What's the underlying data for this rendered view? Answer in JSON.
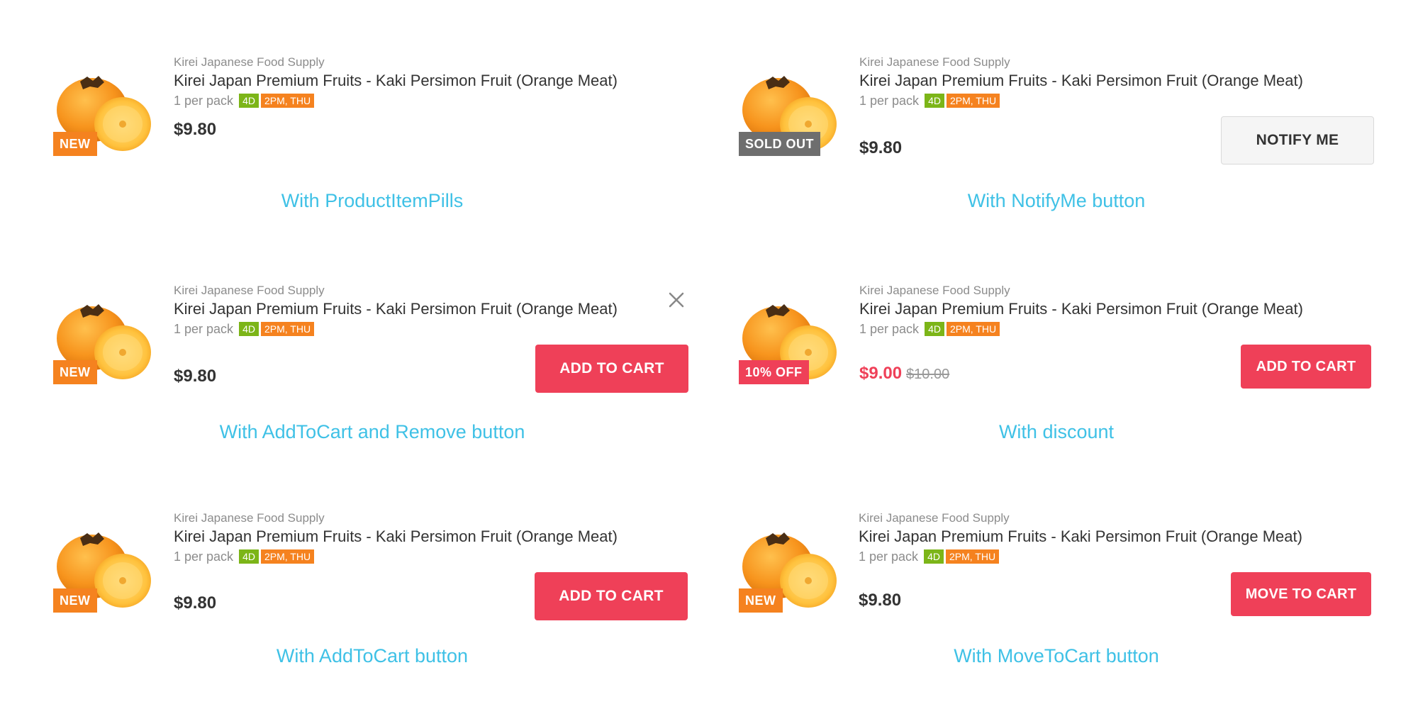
{
  "vendor": "Kirei Japanese Food Supply",
  "product_name": "Kirei Japan Premium Fruits - Kaki Persimon Fruit (Orange Meat)",
  "pack": "1 per pack",
  "pill_days": "4D",
  "pill_time": "2PM, THU",
  "price": "$9.80",
  "cards": {
    "c1": {
      "badge": "NEW",
      "caption": "With ProductItemPills"
    },
    "c2": {
      "badge": "SOLD OUT",
      "button": "NOTIFY ME",
      "caption": "With NotifyMe button"
    },
    "c3": {
      "badge": "NEW",
      "button": "ADD TO CART",
      "caption": "With AddToCart and Remove button"
    },
    "c4": {
      "badge": "10% OFF",
      "sale_price": "$9.00",
      "orig_price": "$10.00",
      "button": "ADD TO CART",
      "caption": "With discount"
    },
    "c5": {
      "badge": "NEW",
      "button": "ADD TO CART",
      "caption": "With AddToCart button"
    },
    "c6": {
      "badge": "NEW",
      "button": "MOVE TO CART",
      "caption": "With MoveToCart button"
    }
  },
  "colors": {
    "accent": "#ef4058",
    "new_badge": "#f5821f",
    "sold_badge": "#6e6e6e",
    "caption": "#3fc1e6",
    "pill_green": "#7cb518",
    "pill_orange": "#f5821f"
  },
  "icons": {
    "remove": "close-icon",
    "product_image": "persimmon-image"
  }
}
